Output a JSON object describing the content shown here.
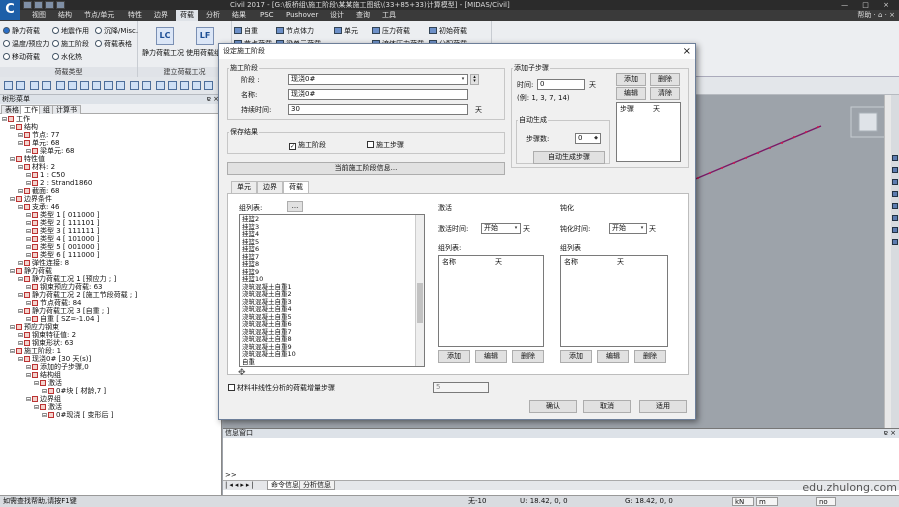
{
  "titlebar": {
    "app_icon": "C",
    "title": "Civil 2017 - [G:\\板桥组\\施工阶段\\某某施工图纸\\(33+85+33)计算模型] - [MIDAS/Civil]",
    "controls": "— □ ×"
  },
  "menu": {
    "items": [
      "视图",
      "结构",
      "节点/单元",
      "特性",
      "边界",
      "荷载",
      "分析",
      "结果",
      "PSC",
      "Pushover",
      "设计",
      "查询",
      "工具"
    ],
    "active_index": 5,
    "help": "帮助 · ⌂ · ×"
  },
  "ribbon": {
    "group1": {
      "label": "荷载类型",
      "items": [
        "静力荷载",
        "地震作用",
        "沉降/Misc.",
        "温度/预应力",
        "施工阶段",
        "荷载表格",
        "移动荷载",
        "水化热"
      ]
    },
    "group2": {
      "label": "建立荷载工况",
      "items": [
        "静力荷载工况",
        "使用荷载组合"
      ]
    },
    "group3": {
      "items": [
        "自重",
        "节点体力",
        "单元",
        "压力荷载",
        "初始荷载",
        "节点荷载",
        "梁单元荷载",
        "流体压力荷载",
        "分配荷载"
      ]
    },
    "btn_lc": "LC",
    "btn_lf": "LF"
  },
  "tree": {
    "header": "树形菜单",
    "pin": "ɐ ×",
    "tabs": [
      "表格",
      "工作",
      "组",
      "计算书"
    ],
    "active_tab": 1,
    "nodes": [
      {
        "d": 0,
        "t": "工作"
      },
      {
        "d": 1,
        "t": "结构"
      },
      {
        "d": 2,
        "t": "节点: 77"
      },
      {
        "d": 2,
        "t": "单元: 68"
      },
      {
        "d": 3,
        "t": "梁单元: 68"
      },
      {
        "d": 1,
        "t": "特性值"
      },
      {
        "d": 2,
        "t": "材料: 2"
      },
      {
        "d": 3,
        "t": "1 : C50"
      },
      {
        "d": 3,
        "t": "2 : Strand1860"
      },
      {
        "d": 2,
        "t": "截面: 68"
      },
      {
        "d": 1,
        "t": "边界条件"
      },
      {
        "d": 2,
        "t": "支承: 46"
      },
      {
        "d": 3,
        "t": "类型 1 [ 011000 ]"
      },
      {
        "d": 3,
        "t": "类型 2 [ 111101 ]"
      },
      {
        "d": 3,
        "t": "类型 3 [ 111111 ]"
      },
      {
        "d": 3,
        "t": "类型 4 [ 101000 ]"
      },
      {
        "d": 3,
        "t": "类型 5 [ 001000 ]"
      },
      {
        "d": 3,
        "t": "类型 6 [ 111000 ]"
      },
      {
        "d": 2,
        "t": "弹性连接: 8"
      },
      {
        "d": 1,
        "t": "静力荷载"
      },
      {
        "d": 2,
        "t": "静力荷载工况 1 [预应力 ;  ]"
      },
      {
        "d": 3,
        "t": "钢束预应力荷载: 63"
      },
      {
        "d": 2,
        "t": "静力荷载工况 2 [施工节段荷载 ;  ]"
      },
      {
        "d": 3,
        "t": "节点荷载: 84"
      },
      {
        "d": 2,
        "t": "静力荷载工况 3 [自重 ;  ]"
      },
      {
        "d": 3,
        "t": "自重 [ SZ=-1.04 ]"
      },
      {
        "d": 1,
        "t": "预应力钢束"
      },
      {
        "d": 2,
        "t": "钢束特征值: 2"
      },
      {
        "d": 2,
        "t": "钢束形状: 63"
      },
      {
        "d": 1,
        "t": "施工阶段: 1"
      },
      {
        "d": 2,
        "t": "现浇0# [30 天(s)]"
      },
      {
        "d": 3,
        "t": "添加的子步骤,0"
      },
      {
        "d": 3,
        "t": "结构组"
      },
      {
        "d": 4,
        "t": "激活"
      },
      {
        "d": 5,
        "t": "0#块 [ 材龄,7 ]"
      },
      {
        "d": 3,
        "t": "边界组"
      },
      {
        "d": 4,
        "t": "激活"
      },
      {
        "d": 5,
        "t": "0#现浇 [ 变形后 ]"
      }
    ]
  },
  "info": {
    "header": "信息窗口",
    "pin": "ɐ ×",
    "prompt": ">>",
    "tabs": [
      "命令信息",
      "分析信息"
    ],
    "active_tab": 0
  },
  "watermark": "edu.zhulong.com",
  "status": {
    "help": "如需查找帮助,请按F1键",
    "node": "无-10",
    "u": "U: 18.42, 0, 0",
    "g": "G: 18.42, 0, 0",
    "unit1": "kN",
    "unit2": "m",
    "unit3": "no"
  },
  "dialog": {
    "title": "设定施工阶段",
    "close": "×",
    "stage_group": "施工阶段",
    "stage_label": "阶段 :",
    "stage_value": "现浇0#",
    "name_label": "名称:",
    "name_value": "现浇0#",
    "duration_label": "持续时间:",
    "duration_value": "30",
    "duration_unit": "天",
    "save_group": "保存结果",
    "save_stage": "施工阶段",
    "save_stage_checked": true,
    "save_step": "施工步骤",
    "save_step_checked": false,
    "info_btn": "当前施工阶段信息...",
    "substep_group": "添加子步骤",
    "time_label": "时间:",
    "time_value": "0",
    "time_unit": "天",
    "time_example": "(例: 1, 3, 7, 14)",
    "add_btn": "添加",
    "del_btn": "删除",
    "edit_btn": "编辑",
    "clear_btn": "清除",
    "sub_col1": "步骤",
    "sub_col2": "天",
    "auto_group": "自动生成",
    "steps_label": "步骤数:",
    "steps_value": "0",
    "auto_btn": "自动生成步骤",
    "tabs": [
      "单元",
      "边界",
      "荷载"
    ],
    "active_tab": 2,
    "group_list_label": "组列表:",
    "group_list_btn": "...",
    "group_items": [
      "挂篮2",
      "挂篮3",
      "挂篮4",
      "挂篮5",
      "挂篮6",
      "挂篮7",
      "挂篮8",
      "挂篮9",
      "挂篮10",
      "浇筑混凝土自重1",
      "浇筑混凝土自重2",
      "浇筑混凝土自重3",
      "浇筑混凝土自重4",
      "浇筑混凝土自重5",
      "浇筑混凝土自重6",
      "浇筑混凝土自重7",
      "浇筑混凝土自重8",
      "浇筑混凝土自重9",
      "浇筑混凝土自重10",
      "自重"
    ],
    "activate_group": "激活",
    "activate_time_label": "激活时间:",
    "activate_time_value": "开始",
    "activate_unit": "天",
    "activate_list_label": "组列表:",
    "col_name": "名称",
    "col_day": "天",
    "deactivate_group": "钝化",
    "deactivate_time_label": "钝化时间:",
    "deactivate_time_value": "开始",
    "deactivate_unit": "天",
    "deactivate_list_label": "组列表",
    "btn_add": "添加",
    "btn_edit": "编辑",
    "btn_delete": "删除",
    "nonlinear_label": "材料非线性分析的荷载增量步骤",
    "nonlinear_checked": false,
    "nonlinear_value": "5",
    "ok": "确认",
    "cancel": "取消",
    "apply": "适用"
  },
  "colors": {
    "accent": "#2a6fc9",
    "ribbon": "#eceef1",
    "menubar": "#3a3a3a",
    "viewport": "#9da3aa",
    "beam": "#7a1a66"
  }
}
